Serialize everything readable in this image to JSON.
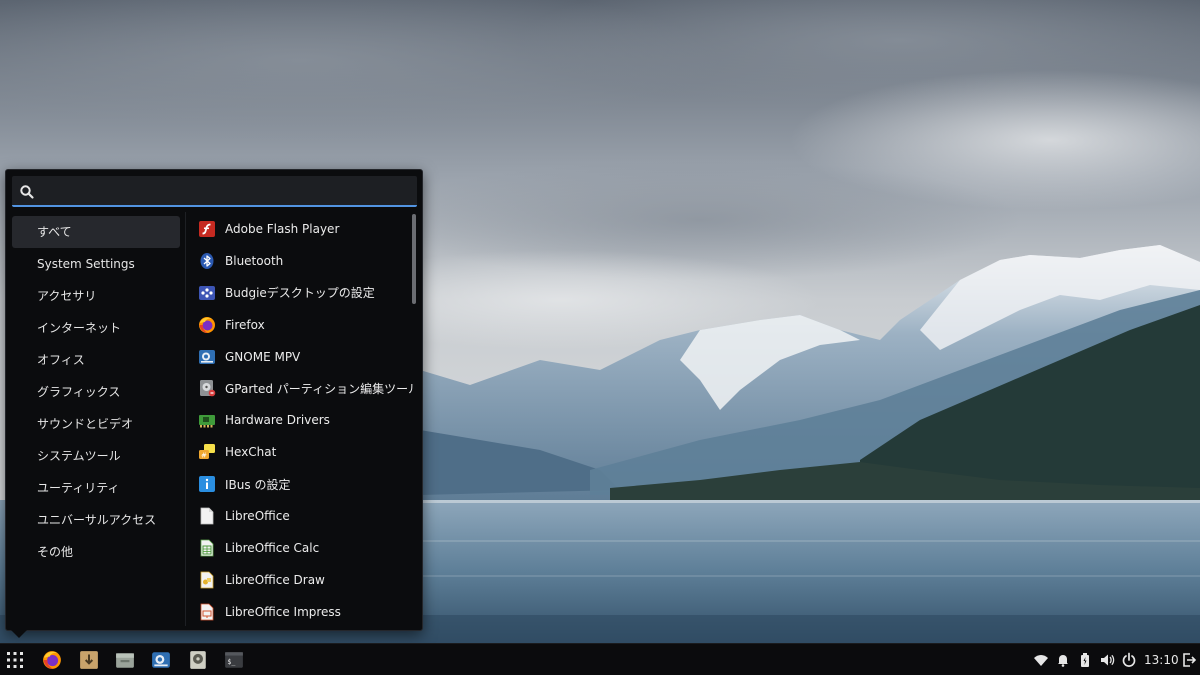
{
  "search": {
    "placeholder": "",
    "value": ""
  },
  "categories": [
    {
      "label": "すべて",
      "active": true
    },
    {
      "label": "System Settings"
    },
    {
      "label": "アクセサリ"
    },
    {
      "label": "インターネット"
    },
    {
      "label": "オフィス"
    },
    {
      "label": "グラフィックス"
    },
    {
      "label": "サウンドとビデオ"
    },
    {
      "label": "システムツール"
    },
    {
      "label": "ユーティリティ"
    },
    {
      "label": "ユニバーサルアクセス"
    },
    {
      "label": "その他"
    }
  ],
  "apps": [
    {
      "label": "Adobe Flash Player",
      "icon": "flash-player-icon"
    },
    {
      "label": "Bluetooth",
      "icon": "bluetooth-icon"
    },
    {
      "label": "Budgieデスクトップの設定",
      "icon": "budgie-settings-icon"
    },
    {
      "label": "Firefox",
      "icon": "firefox-icon"
    },
    {
      "label": "GNOME MPV",
      "icon": "gnome-mpv-icon"
    },
    {
      "label": "GParted パーティション編集ツール",
      "icon": "gparted-icon"
    },
    {
      "label": "Hardware Drivers",
      "icon": "hardware-drivers-icon"
    },
    {
      "label": "HexChat",
      "icon": "hexchat-icon"
    },
    {
      "label": "IBus の設定",
      "icon": "ibus-info-icon"
    },
    {
      "label": "LibreOffice",
      "icon": "libreoffice-icon"
    },
    {
      "label": "LibreOffice Calc",
      "icon": "libreoffice-calc-icon"
    },
    {
      "label": "LibreOffice Draw",
      "icon": "libreoffice-draw-icon"
    },
    {
      "label": "LibreOffice Impress",
      "icon": "libreoffice-impress-icon"
    }
  ],
  "panel": {
    "launchers": [
      "app-grid-icon",
      "firefox-icon",
      "software-installer-icon",
      "file-manager-icon",
      "gnome-mpv-icon",
      "disk-tool-icon",
      "terminal-icon"
    ],
    "tray": [
      "wifi-icon",
      "notification-bell-icon",
      "battery-icon",
      "volume-icon",
      "power-icon"
    ],
    "clock": "13:10",
    "logout_icon": "logout-icon"
  },
  "colors": {
    "accent": "#5294e2",
    "menu_bg": "#0b0c0e",
    "panel_bg": "#0b0b0d"
  }
}
